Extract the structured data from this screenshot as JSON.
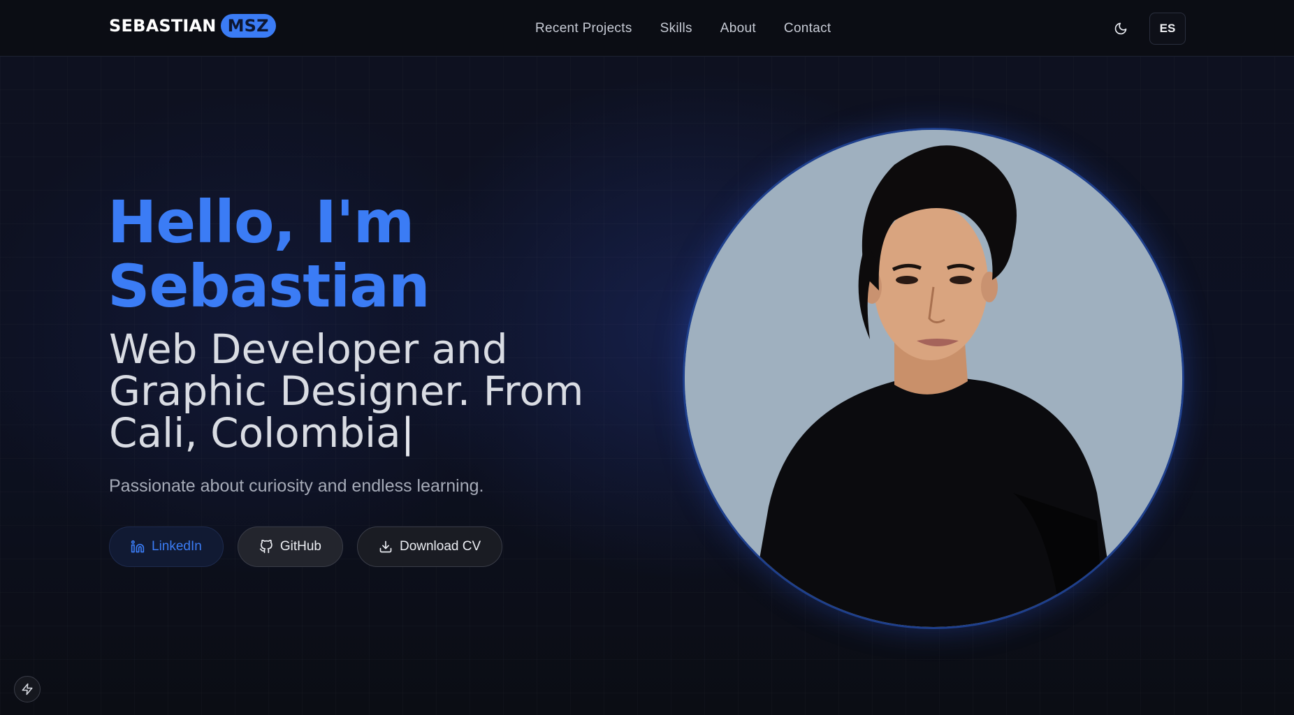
{
  "header": {
    "logo_name": "SEBASTIAN",
    "logo_badge": "MSZ",
    "nav": [
      {
        "label": "Recent Projects"
      },
      {
        "label": "Skills"
      },
      {
        "label": "About"
      },
      {
        "label": "Contact"
      }
    ],
    "theme_icon": "moon-icon",
    "language_label": "ES"
  },
  "hero": {
    "greeting_line1": "Hello, I'm",
    "greeting_line2": "Sebastian",
    "role": "Web Developer and Graphic Designer. From Cali, Colombia",
    "caret": "|",
    "tagline": "Passionate about curiosity and endless learning.",
    "buttons": [
      {
        "label": "LinkedIn",
        "icon": "linkedin-icon"
      },
      {
        "label": "GitHub",
        "icon": "github-icon"
      },
      {
        "label": "Download CV",
        "icon": "download-icon"
      }
    ]
  },
  "colors": {
    "accent": "#3b7cf5",
    "background": "#0b0d14",
    "portrait_background": "#9fb0bf"
  },
  "floating_icon": "lightning-icon"
}
